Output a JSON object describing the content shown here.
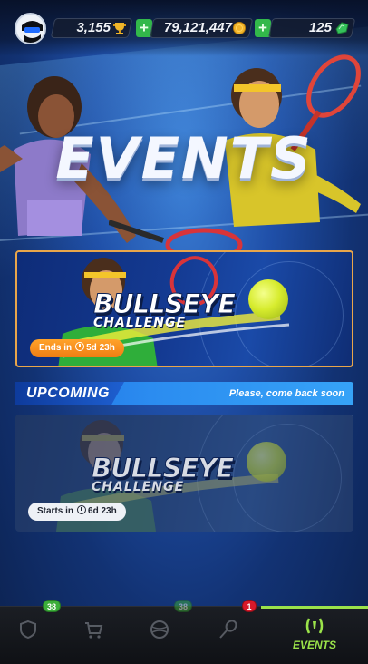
{
  "header": {
    "trophies": "3,155",
    "coins": "79,121,447",
    "gems": "125",
    "plus_label": "+"
  },
  "title": "EVENTS",
  "active_event": {
    "name_line1": "BULLSEYE",
    "name_line2": "CHALLENGE",
    "timer_prefix": "Ends in",
    "timer_value": "5d 23h"
  },
  "upcoming": {
    "label": "UPCOMING",
    "note": "Please, come back soon",
    "event": {
      "name_line1": "BULLSEYE",
      "name_line2": "CHALLENGE",
      "timer_prefix": "Starts in",
      "timer_value": "6d 23h"
    }
  },
  "nav": {
    "badges": {
      "badge_a": "38",
      "badge_b": "38",
      "badge_c": "1"
    },
    "active_label": "EVENTS",
    "items": [
      "shield-icon",
      "shop-icon",
      "ball-icon",
      "rackets-icon",
      "events-icon"
    ]
  },
  "colors": {
    "accent_green": "#9be34a",
    "timer_orange": "#f07d13",
    "upcoming_blue": "#2b8cf0",
    "badge_red": "#d8192a"
  }
}
